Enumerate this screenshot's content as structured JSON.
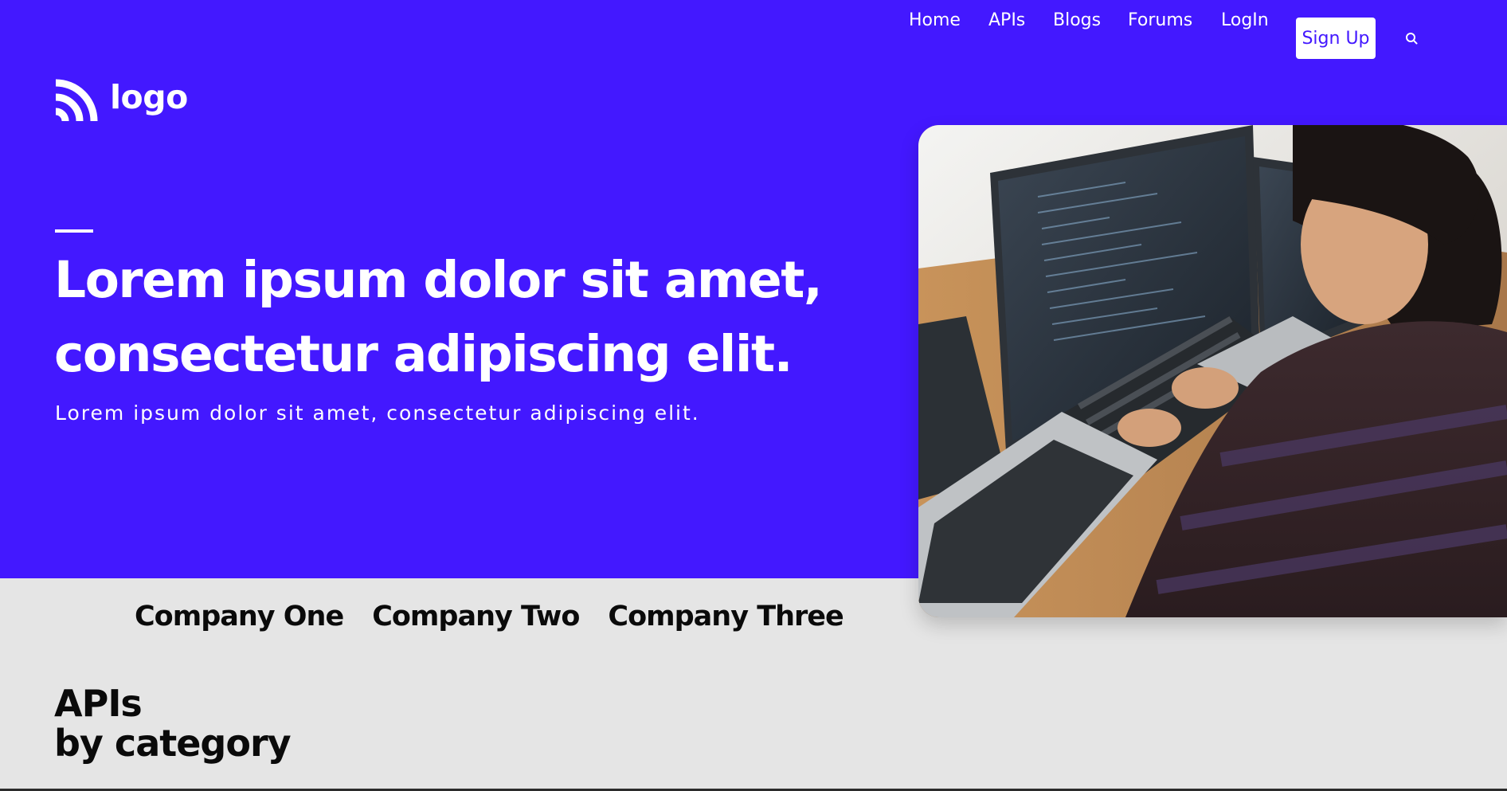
{
  "nav": {
    "items": [
      "Home",
      "APIs",
      "Blogs",
      "Forums",
      "LogIn"
    ],
    "signup_label": "Sign Up",
    "search_icon": "search-icon"
  },
  "logo": {
    "text": "logo",
    "icon": "signal-waves-icon"
  },
  "hero": {
    "headline_line1": "Lorem ipsum dolor sit amet,",
    "headline_line2": "consectetur adipiscing elit.",
    "subheading": "Lorem ipsum dolor sit amet, consectetur adipiscing elit.",
    "image_icon": "developer-at-computer-photo"
  },
  "companies": [
    "Company One",
    "Company Two",
    "Company Three"
  ],
  "apis_section": {
    "title_line1": "APIs",
    "title_line2": "by category"
  },
  "colors": {
    "brand": "#4318ff",
    "background": "#e5e5e5",
    "text_dark": "#0a0a0a",
    "white": "#ffffff"
  }
}
